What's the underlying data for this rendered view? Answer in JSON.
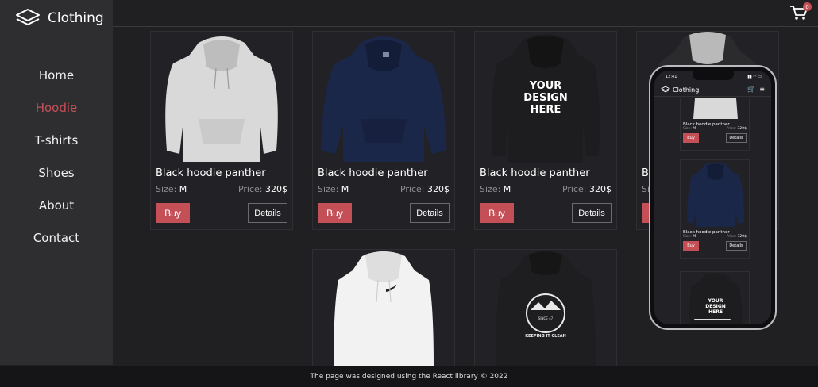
{
  "brand": {
    "name": "Clothing"
  },
  "nav": {
    "items": [
      {
        "label": "Home"
      },
      {
        "label": "Hoodie",
        "active": true
      },
      {
        "label": "T-shirts"
      },
      {
        "label": "Shoes"
      },
      {
        "label": "About"
      },
      {
        "label": "Contact"
      }
    ]
  },
  "cart": {
    "count": "0"
  },
  "products": [
    {
      "name": "Black hoodie panther",
      "size_label": "Size:",
      "size": "M",
      "price_label": "Price:",
      "price": "320$",
      "buy": "Buy",
      "details": "Details"
    },
    {
      "name": "Black hoodie panther",
      "size_label": "Size:",
      "size": "M",
      "price_label": "Price:",
      "price": "320$",
      "buy": "Buy",
      "details": "Details"
    },
    {
      "name": "Black hoodie panther",
      "size_label": "Size:",
      "size": "M",
      "price_label": "Price:",
      "price": "320$",
      "buy": "Buy",
      "details": "Details"
    },
    {
      "name": "B",
      "size_label": "Si",
      "buy": ""
    }
  ],
  "print_text": {
    "line1": "YOUR",
    "line2": "DESIGN",
    "line3": "HERE",
    "back_top": "SINCE 47",
    "back_bottom": "KEEPING IT CLEAN"
  },
  "phone": {
    "time": "12:41",
    "brand": "Clothing",
    "cart_count": "0",
    "product": {
      "name": "Black hoodie panther",
      "size_label": "Size:",
      "size": "M",
      "price_label": "Price:",
      "price": "320$",
      "buy": "Buy",
      "details": "Details"
    },
    "print": {
      "line1": "YOUR",
      "line2": "DESIGN",
      "line3": "HERE"
    }
  },
  "footer": {
    "text": "The page was designed using the React library © 2022"
  },
  "colors": {
    "accent": "#c44f57",
    "sidebar": "#2e2e31",
    "background": "#202023"
  }
}
